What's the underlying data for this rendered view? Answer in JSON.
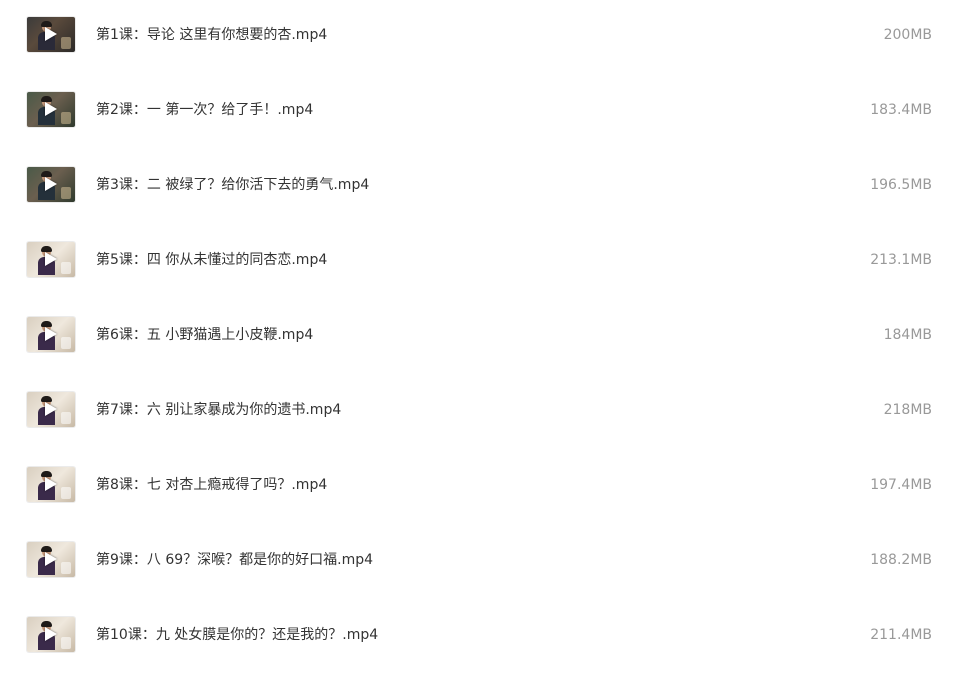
{
  "files": [
    {
      "name": "第1课：导论 这里有你想要的杏.mp4",
      "size": "200MB",
      "thumb_style": "dark"
    },
    {
      "name": "第2课：一 第一次？给了手！.mp4",
      "size": "183.4MB",
      "thumb_style": "dark2"
    },
    {
      "name": "第3课：二 被绿了？给你活下去的勇气.mp4",
      "size": "196.5MB",
      "thumb_style": "dark2"
    },
    {
      "name": "第5课：四 你从未懂过的同杏恋.mp4",
      "size": "213.1MB",
      "thumb_style": "light"
    },
    {
      "name": "第6课：五 小野猫遇上小皮鞭.mp4",
      "size": "184MB",
      "thumb_style": "light"
    },
    {
      "name": "第7课：六 别让家暴成为你的遗书.mp4",
      "size": "218MB",
      "thumb_style": "light"
    },
    {
      "name": "第8课：七 对杏上瘾戒得了吗？.mp4",
      "size": "197.4MB",
      "thumb_style": "light"
    },
    {
      "name": "第9课：八 69？深喉？都是你的好口福.mp4",
      "size": "188.2MB",
      "thumb_style": "light"
    },
    {
      "name": "第10课：九 处女膜是你的？还是我的？.mp4",
      "size": "211.4MB",
      "thumb_style": "light"
    }
  ],
  "icons": {
    "thumbnail_overlay": "play-icon"
  },
  "colors": {
    "name_text": "#333333",
    "size_text": "#999999",
    "background": "#ffffff"
  }
}
